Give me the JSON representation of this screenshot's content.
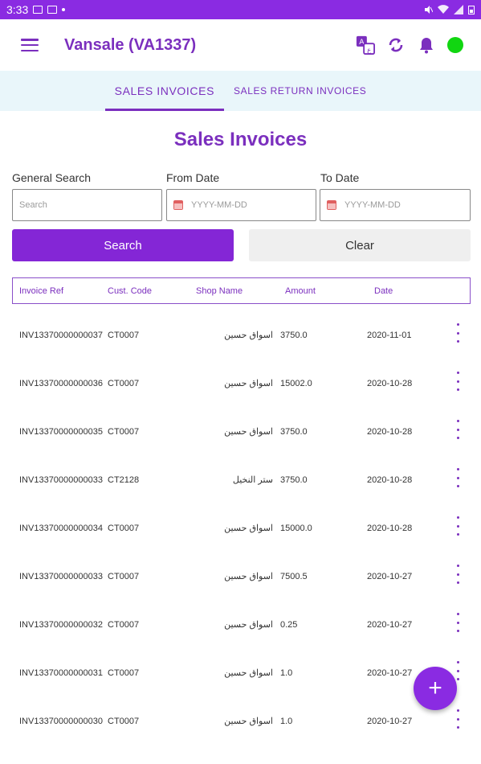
{
  "status_bar": {
    "time": "3:33"
  },
  "app_bar": {
    "title": "Vansale (VA1337)"
  },
  "tabs": [
    {
      "label": "SALES INVOICES"
    },
    {
      "label": "SALES RETURN INVOICES"
    }
  ],
  "page": {
    "title": "Sales Invoices"
  },
  "filters": {
    "general_search_label": "General Search",
    "general_search_placeholder": "Search",
    "from_date_label": "From Date",
    "from_date_placeholder": "YYYY-MM-DD",
    "to_date_label": "To Date",
    "to_date_placeholder": "YYYY-MM-DD",
    "search_button": "Search",
    "clear_button": "Clear"
  },
  "table": {
    "columns": [
      "Invoice Ref",
      "Cust. Code",
      "Shop Name",
      "Amount",
      "Date"
    ],
    "rows": [
      {
        "ref": "INV13370000000037",
        "code": "CT0007",
        "shop": "اسواق حسين",
        "amount": "3750.0",
        "date": "2020-11-01"
      },
      {
        "ref": "INV13370000000036",
        "code": "CT0007",
        "shop": "اسواق حسين",
        "amount": "15002.0",
        "date": "2020-10-28"
      },
      {
        "ref": "INV13370000000035",
        "code": "CT0007",
        "shop": "اسواق حسين",
        "amount": "3750.0",
        "date": "2020-10-28"
      },
      {
        "ref": "INV13370000000033",
        "code": "CT2128",
        "shop": "ستر النخيل",
        "amount": "3750.0",
        "date": "2020-10-28"
      },
      {
        "ref": "INV13370000000034",
        "code": "CT0007",
        "shop": "اسواق حسين",
        "amount": "15000.0",
        "date": "2020-10-28"
      },
      {
        "ref": "INV13370000000033",
        "code": "CT0007",
        "shop": "اسواق حسين",
        "amount": "7500.5",
        "date": "2020-10-27"
      },
      {
        "ref": "INV13370000000032",
        "code": "CT0007",
        "shop": "اسواق حسين",
        "amount": "0.25",
        "date": "2020-10-27"
      },
      {
        "ref": "INV13370000000031",
        "code": "CT0007",
        "shop": "اسواق حسين",
        "amount": "1.0",
        "date": "2020-10-27"
      },
      {
        "ref": "INV13370000000030",
        "code": "CT0007",
        "shop": "اسواق حسين",
        "amount": "1.0",
        "date": "2020-10-27"
      }
    ]
  },
  "fab": {
    "label": "+"
  },
  "colors": {
    "primary": "#8a2be2",
    "online": "#11d611",
    "tab_bg": "#e9f6fa"
  },
  "icons": [
    "menu-icon",
    "translate-icon",
    "sync-icon",
    "bell-icon",
    "online-status-dot",
    "calendar-icon",
    "more-vert-icon",
    "add-icon"
  ]
}
